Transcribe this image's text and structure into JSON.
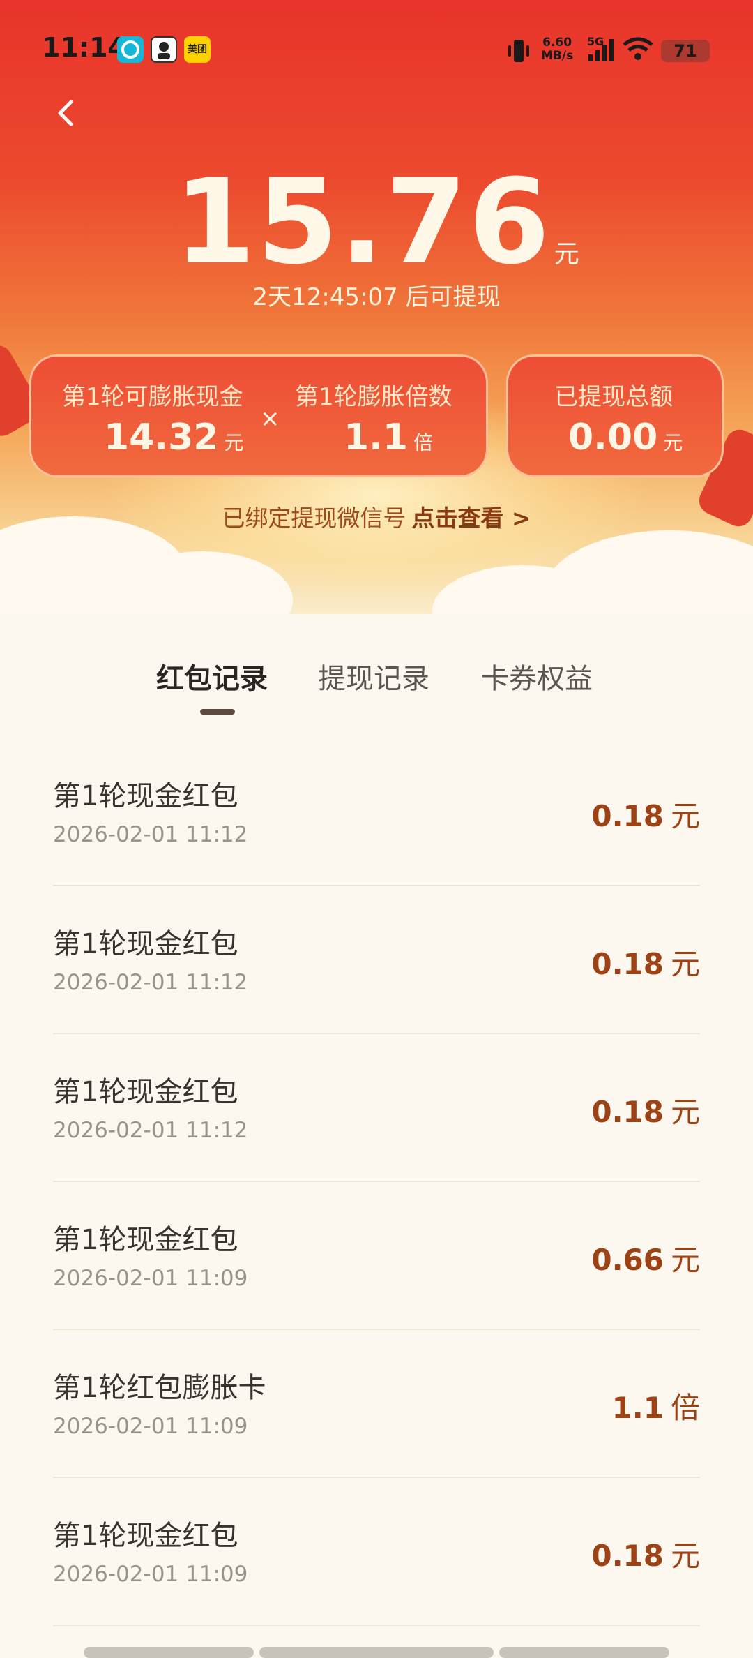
{
  "status_bar": {
    "time": "11:14",
    "app_icons": [
      "compass-app-icon",
      "avatar-app-icon",
      "meituan-app-icon"
    ],
    "meituan_label": "美团",
    "net_speed_value": "6.60",
    "net_speed_unit": "MB/s",
    "signal_label": "5G",
    "battery": "71"
  },
  "header": {
    "amount": "15.76",
    "amount_unit": "元",
    "countdown": "2天12:45:07 后可提现"
  },
  "cards": {
    "expandable_cash_label": "第1轮可膨胀现金",
    "expandable_cash_value": "14.32",
    "expandable_cash_unit": "元",
    "multiplier_sign": "×",
    "multiplier_label": "第1轮膨胀倍数",
    "multiplier_value": "1.1",
    "multiplier_unit": "倍",
    "withdrawn_label": "已提现总额",
    "withdrawn_value": "0.00",
    "withdrawn_unit": "元"
  },
  "bind_notice": {
    "text": "已绑定提现微信号",
    "link": "点击查看 >"
  },
  "tabs": [
    {
      "label": "红包记录",
      "active": true
    },
    {
      "label": "提现记录",
      "active": false
    },
    {
      "label": "卡券权益",
      "active": false
    }
  ],
  "records": [
    {
      "title": "第1轮现金红包",
      "date": "2026-02-01 11:12",
      "amount": "0.18",
      "unit": "元"
    },
    {
      "title": "第1轮现金红包",
      "date": "2026-02-01 11:12",
      "amount": "0.18",
      "unit": "元"
    },
    {
      "title": "第1轮现金红包",
      "date": "2026-02-01 11:12",
      "amount": "0.18",
      "unit": "元"
    },
    {
      "title": "第1轮现金红包",
      "date": "2026-02-01 11:09",
      "amount": "0.66",
      "unit": "元"
    },
    {
      "title": "第1轮红包膨胀卡",
      "date": "2026-02-01 11:09",
      "amount": "1.1",
      "unit": "倍"
    },
    {
      "title": "第1轮现金红包",
      "date": "2026-02-01 11:09",
      "amount": "0.18",
      "unit": "元"
    }
  ],
  "colors": {
    "hero_red": "#e8332b",
    "page_bg": "#fcf8ef",
    "amount_brown": "#9c4215"
  }
}
